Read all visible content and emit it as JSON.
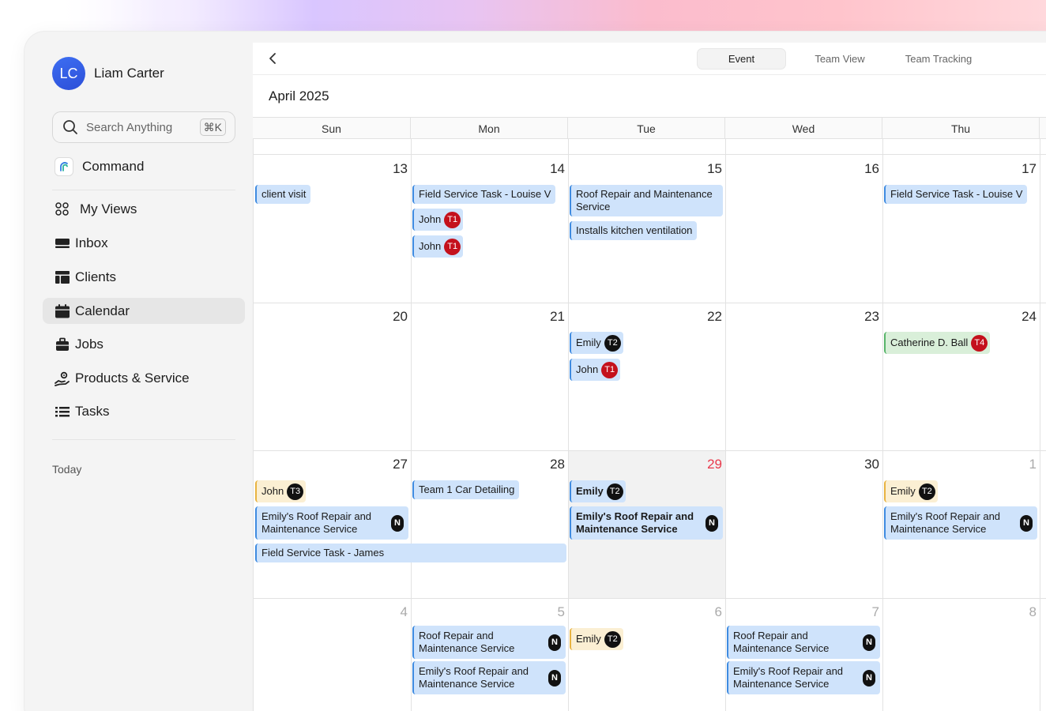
{
  "user": {
    "initials": "LC",
    "name": "Liam Carter"
  },
  "search": {
    "placeholder": "Search Anything",
    "shortcut": "⌘K"
  },
  "command": {
    "label": "Command"
  },
  "nav": [
    {
      "label": "My Views",
      "icon": "grid-dots-icon"
    },
    {
      "label": "Inbox",
      "icon": "inbox-icon"
    },
    {
      "label": "Clients",
      "icon": "table-icon"
    },
    {
      "label": "Calendar",
      "icon": "calendar-icon",
      "active": true
    },
    {
      "label": "Jobs",
      "icon": "briefcase-icon"
    },
    {
      "label": "Products & Service",
      "icon": "hand-gear-icon"
    },
    {
      "label": "Tasks",
      "icon": "list-icon"
    }
  ],
  "today_label": "Today",
  "tabs": [
    "Event",
    "Team View",
    "Team Tracking"
  ],
  "active_tab": "Event",
  "month_title": "April 2025",
  "weekdays": [
    "Sun",
    "Mon",
    "Tue",
    "Wed",
    "Thu"
  ],
  "weeks": [
    [
      "13",
      "14",
      "15",
      "16",
      "17"
    ],
    [
      "20",
      "21",
      "22",
      "23",
      "24"
    ],
    [
      "27",
      "28",
      "29",
      "30",
      "1"
    ],
    [
      "4",
      "5",
      "6",
      "7",
      "8"
    ]
  ],
  "today_date": "29",
  "events": {
    "w1_sun_1": "client visit",
    "w1_mon_1": "Field Service Task - Louise V",
    "w1_mon_2": "John",
    "w1_mon_3": "John",
    "w1_tue_1": "Roof Repair and Maintenance Service",
    "w1_tue_2": "Installs kitchen ventilation",
    "w1_thu_1": "Field Service Task - Louise V",
    "w2_tue_1": "Emily",
    "w2_tue_2": "John",
    "w2_thu_1": "Catherine D. Ball",
    "w3_sun_1": "John",
    "w3_sun_2": "Emily's Roof Repair and Maintenance Service",
    "w3_sun_3": "Field Service Task - James",
    "w3_mon_1": "Team 1 Car Detailing",
    "w3_tue_1": "Emily",
    "w3_tue_2": "Emily's Roof Repair and Maintenance Service",
    "w3_thu_1": "Emily",
    "w3_thu_2": "Emily's Roof Repair and Maintenance Service",
    "w4_mon_1": "Roof Repair and Maintenance Service",
    "w4_mon_2": "Emily's Roof Repair and Maintenance Service",
    "w4_tue_1": "Emily",
    "w4_wed_1": "Roof Repair and Maintenance Service",
    "w4_wed_2": "Emily's Roof Repair and Maintenance Service"
  },
  "badges": {
    "t1": "T1",
    "t2": "T2",
    "t3": "T3",
    "t4": "T4",
    "n": "N"
  },
  "colors": {
    "event_blue": "#cfe3fb",
    "event_yellow": "#fbefd3",
    "event_green": "#d9efd9",
    "badge_red": "#c4111c",
    "today_red": "#e8394b",
    "avatar_blue": "#3d6ef2"
  }
}
